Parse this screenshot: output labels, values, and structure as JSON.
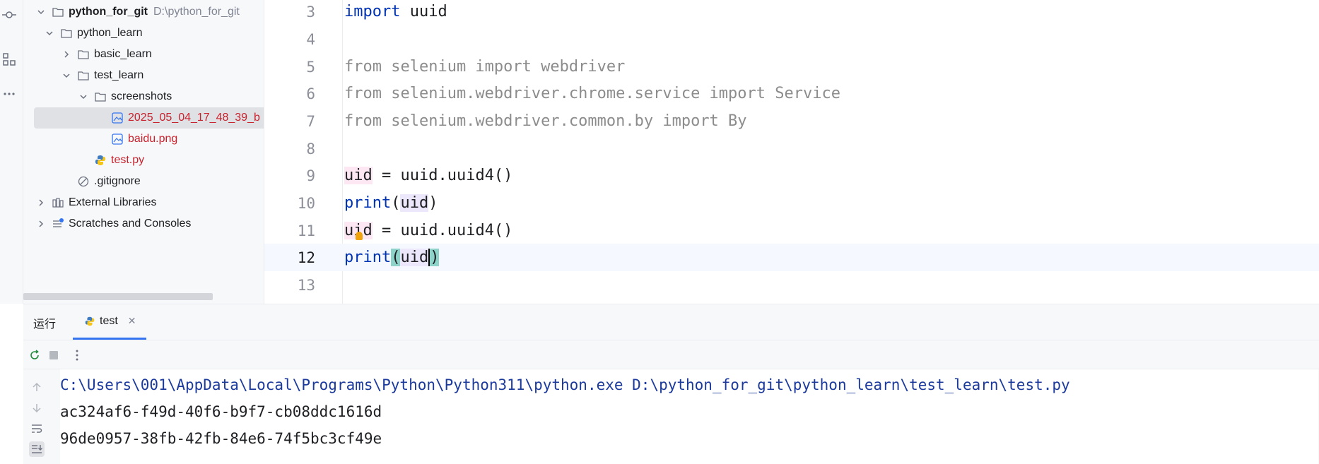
{
  "activity": {
    "icons": [
      "commit-icon",
      "structure-icon",
      "more-icon"
    ]
  },
  "tree": {
    "root": {
      "name": "python_for_git",
      "path": "D:\\python_for_git"
    },
    "python_learn": "python_learn",
    "basic_learn": "basic_learn",
    "test_learn": "test_learn",
    "screenshots": "screenshots",
    "screenshot_file": "2025_05_04_17_48_39_b",
    "baidu_file": "baidu.png",
    "test_file": "test.py",
    "gitignore": ".gitignore",
    "external_libraries": "External Libraries",
    "scratches": "Scratches and Consoles"
  },
  "editor": {
    "lines": [
      {
        "num": "3",
        "code": "import uuid"
      },
      {
        "num": "4",
        "code": ""
      },
      {
        "num": "5",
        "code": "from selenium import webdriver"
      },
      {
        "num": "6",
        "code": "from selenium.webdriver.chrome.service import Service"
      },
      {
        "num": "7",
        "code": "from selenium.webdriver.common.by import By"
      },
      {
        "num": "8",
        "code": ""
      },
      {
        "num": "9",
        "code": "uid = uuid.uuid4()"
      },
      {
        "num": "10",
        "code": "print(uid)"
      },
      {
        "num": "11",
        "code": "uid = uuid.uuid4()"
      },
      {
        "num": "12",
        "code": "print(uid)"
      },
      {
        "num": "13",
        "code": ""
      }
    ]
  },
  "run": {
    "title": "运行",
    "tab_label": "test",
    "console": {
      "command": "C:\\Users\\001\\AppData\\Local\\Programs\\Python\\Python311\\python.exe D:\\python_for_git\\python_learn\\test_learn\\test.py",
      "output1": "ac324af6-f49d-40f6-b9f7-cb08ddc1616d",
      "output2": "96de0957-38fb-42fb-84e6-74f5bc3cf49e"
    }
  }
}
